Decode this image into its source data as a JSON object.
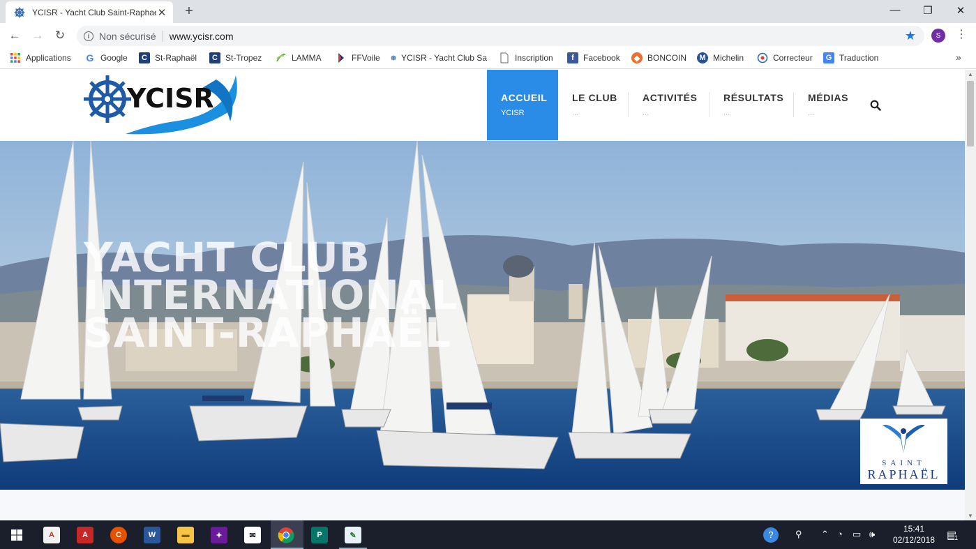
{
  "browser": {
    "tab_title": "YCISR - Yacht Club Saint-Raphael",
    "new_tab_symbol": "+",
    "window_controls": {
      "minimize": "—",
      "restore": "❐",
      "close": "✕"
    },
    "nav": {
      "back": "←",
      "forward": "→",
      "reload": "↻"
    },
    "security_label": "Non sécurisé",
    "url": "www.ycisr.com",
    "profile_initial": "S",
    "menu_symbol": "⋮",
    "bookmark_star_color": "#1a73e8"
  },
  "bookmarks": [
    {
      "label": "Applications",
      "icon": "apps-grid-icon"
    },
    {
      "label": "Google",
      "icon": "google-icon"
    },
    {
      "label": "St-Raphaël",
      "icon": "webcam-icon"
    },
    {
      "label": "St-Tropez",
      "icon": "webcam-icon"
    },
    {
      "label": "LAMMA",
      "icon": "lamma-icon"
    },
    {
      "label": "FFVoile",
      "icon": "ffvoile-icon"
    },
    {
      "label": "YCISR - Yacht Club Sa",
      "icon": "ycisr-wheel-icon"
    },
    {
      "label": "Inscription",
      "icon": "page-icon"
    },
    {
      "label": "Facebook",
      "icon": "facebook-icon"
    },
    {
      "label": "BONCOIN",
      "icon": "boncoin-icon"
    },
    {
      "label": "Michelin",
      "icon": "michelin-icon"
    },
    {
      "label": "Correcteur",
      "icon": "correcteur-icon"
    },
    {
      "label": "Traduction",
      "icon": "translate-icon"
    }
  ],
  "bookmarks_more": "»",
  "site": {
    "logo_text": "YCISR",
    "nav": [
      {
        "label": "ACCUEIL",
        "sub": "YCISR",
        "active": true
      },
      {
        "label": "LE CLUB",
        "sub": "...",
        "active": false
      },
      {
        "label": "ACTIVITÉS",
        "sub": "...",
        "active": false
      },
      {
        "label": "RÉSULTATS",
        "sub": "...",
        "active": false
      },
      {
        "label": "MÉDIAS",
        "sub": "...",
        "active": false
      }
    ],
    "accent_color": "#2b8ce8",
    "hero": {
      "title_line1": "YACHT CLUB",
      "title_line2": "INTERNATIONAL",
      "title_line3": "SAINT-RAPHAËL",
      "badge_line1": "SAINT",
      "badge_line2": "RAPHAËL"
    }
  },
  "taskbar": {
    "apps": [
      "windows-start-icon",
      "acrobat-reader-icon",
      "acrobat-icon",
      "ccleaner-icon",
      "word-icon",
      "file-explorer-icon",
      "media-app-icon",
      "mail-icon",
      "chrome-icon",
      "publisher-icon",
      "notepad-icon"
    ],
    "time": "15:41",
    "date": "02/12/2018",
    "notification_count": "1"
  }
}
